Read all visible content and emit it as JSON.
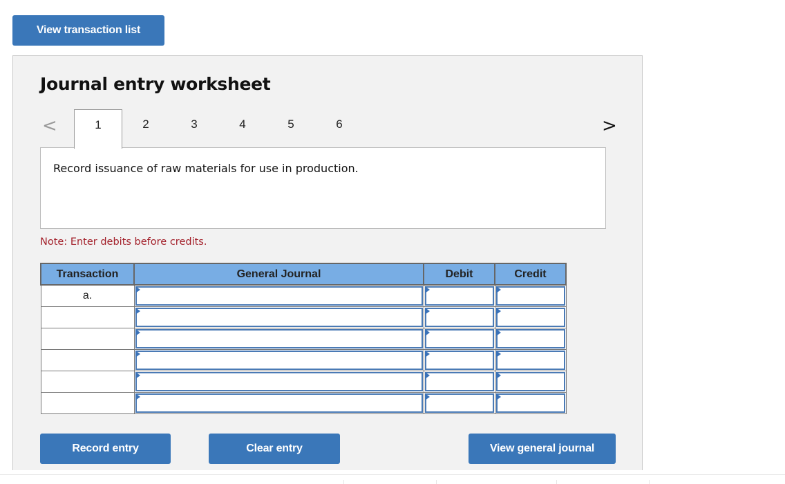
{
  "top": {
    "view_transaction_list_label": "View transaction list"
  },
  "worksheet": {
    "title": "Journal entry worksheet",
    "nav": {
      "prev_icon": "chevron-left-icon",
      "next_icon": "chevron-right-icon",
      "prev_glyph": "<",
      "next_glyph": ">"
    },
    "tabs": [
      {
        "label": "1",
        "active": true
      },
      {
        "label": "2",
        "active": false
      },
      {
        "label": "3",
        "active": false
      },
      {
        "label": "4",
        "active": false
      },
      {
        "label": "5",
        "active": false
      },
      {
        "label": "6",
        "active": false
      }
    ],
    "description": "Record issuance of raw materials for use in production.",
    "note": "Note: Enter debits before credits.",
    "table": {
      "headers": {
        "transaction": "Transaction",
        "general_journal": "General Journal",
        "debit": "Debit",
        "credit": "Credit"
      },
      "rows": [
        {
          "transaction": "a.",
          "account": "",
          "debit": "",
          "credit": ""
        },
        {
          "transaction": "",
          "account": "",
          "debit": "",
          "credit": ""
        },
        {
          "transaction": "",
          "account": "",
          "debit": "",
          "credit": ""
        },
        {
          "transaction": "",
          "account": "",
          "debit": "",
          "credit": ""
        },
        {
          "transaction": "",
          "account": "",
          "debit": "",
          "credit": ""
        },
        {
          "transaction": "",
          "account": "",
          "debit": "",
          "credit": ""
        }
      ]
    },
    "buttons": {
      "record": "Record entry",
      "clear": "Clear entry",
      "view_general_journal": "View general journal"
    }
  },
  "colors": {
    "button": "#3a77b9",
    "header": "#78ade4",
    "note": "#a3202a",
    "panel": "#f2f2f2"
  }
}
